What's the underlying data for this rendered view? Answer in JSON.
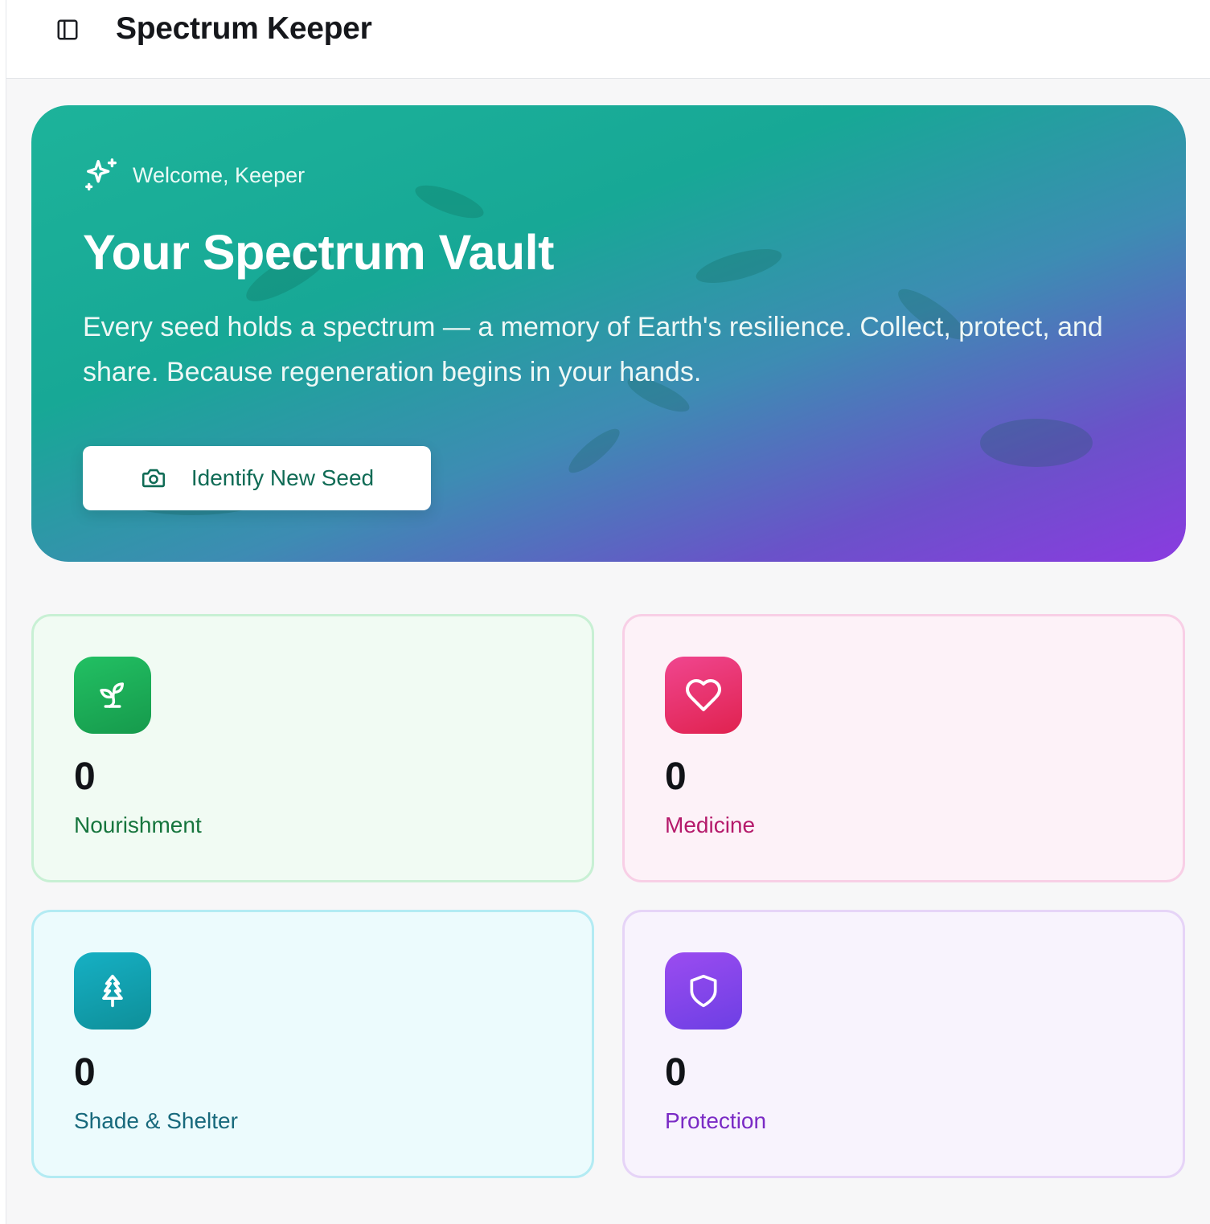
{
  "header": {
    "app_title": "Spectrum Keeper"
  },
  "hero": {
    "welcome": "Welcome, Keeper",
    "title": "Your Spectrum Vault",
    "description": "Every seed holds a spectrum — a memory of Earth's resilience. Collect, protect, and share. Because regeneration begins in your hands.",
    "cta_label": "Identify New Seed",
    "gradient_colors": [
      "#1db39a",
      "#3d8cb3",
      "#8a3be0"
    ]
  },
  "stats": [
    {
      "count": "0",
      "label": "Nourishment",
      "icon": "sprout-icon",
      "color": "#16753d"
    },
    {
      "count": "0",
      "label": "Medicine",
      "icon": "heart-icon",
      "color": "#b51a6b"
    },
    {
      "count": "0",
      "label": "Shade & Shelter",
      "icon": "tree-icon",
      "color": "#17697c"
    },
    {
      "count": "0",
      "label": "Protection",
      "icon": "shield-icon",
      "color": "#7a2ac5"
    }
  ]
}
